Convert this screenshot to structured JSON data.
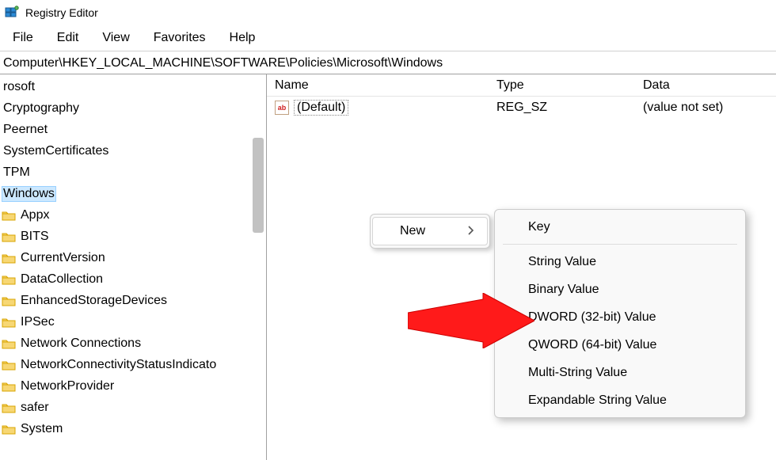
{
  "window": {
    "title": "Registry Editor"
  },
  "menubar": {
    "items": [
      {
        "label": "File"
      },
      {
        "label": "Edit"
      },
      {
        "label": "View"
      },
      {
        "label": "Favorites"
      },
      {
        "label": "Help"
      }
    ]
  },
  "addressbar": {
    "path": "Computer\\HKEY_LOCAL_MACHINE\\SOFTWARE\\Policies\\Microsoft\\Windows"
  },
  "tree": {
    "items": [
      {
        "label": "rosoft",
        "folder": false,
        "selected": false
      },
      {
        "label": "Cryptography",
        "folder": false,
        "selected": false
      },
      {
        "label": "Peernet",
        "folder": false,
        "selected": false
      },
      {
        "label": "SystemCertificates",
        "folder": false,
        "selected": false
      },
      {
        "label": "TPM",
        "folder": false,
        "selected": false
      },
      {
        "label": "Windows",
        "folder": false,
        "selected": true
      },
      {
        "label": "Appx",
        "folder": true,
        "selected": false
      },
      {
        "label": "BITS",
        "folder": true,
        "selected": false
      },
      {
        "label": "CurrentVersion",
        "folder": true,
        "selected": false
      },
      {
        "label": "DataCollection",
        "folder": true,
        "selected": false
      },
      {
        "label": "EnhancedStorageDevices",
        "folder": true,
        "selected": false
      },
      {
        "label": "IPSec",
        "folder": true,
        "selected": false
      },
      {
        "label": "Network Connections",
        "folder": true,
        "selected": false
      },
      {
        "label": "NetworkConnectivityStatusIndicato",
        "folder": true,
        "selected": false
      },
      {
        "label": "NetworkProvider",
        "folder": true,
        "selected": false
      },
      {
        "label": "safer",
        "folder": true,
        "selected": false
      },
      {
        "label": "System",
        "folder": true,
        "selected": false
      }
    ]
  },
  "list": {
    "columns": {
      "name": "Name",
      "type": "Type",
      "data": "Data"
    },
    "rows": [
      {
        "name": "(Default)",
        "type": "REG_SZ",
        "data": "(value not set)",
        "icon": "ab"
      }
    ]
  },
  "context_parent": {
    "items": [
      {
        "label": "New",
        "submenu": true
      }
    ]
  },
  "context_sub": {
    "items": [
      {
        "label": "Key"
      },
      {
        "sep": true
      },
      {
        "label": "String Value"
      },
      {
        "label": "Binary Value"
      },
      {
        "label": "DWORD (32-bit) Value"
      },
      {
        "label": "QWORD (64-bit) Value"
      },
      {
        "label": "Multi-String Value"
      },
      {
        "label": "Expandable String Value"
      }
    ]
  },
  "icons": {
    "folder_fill": "#f7d774",
    "folder_stroke": "#d9a400"
  }
}
